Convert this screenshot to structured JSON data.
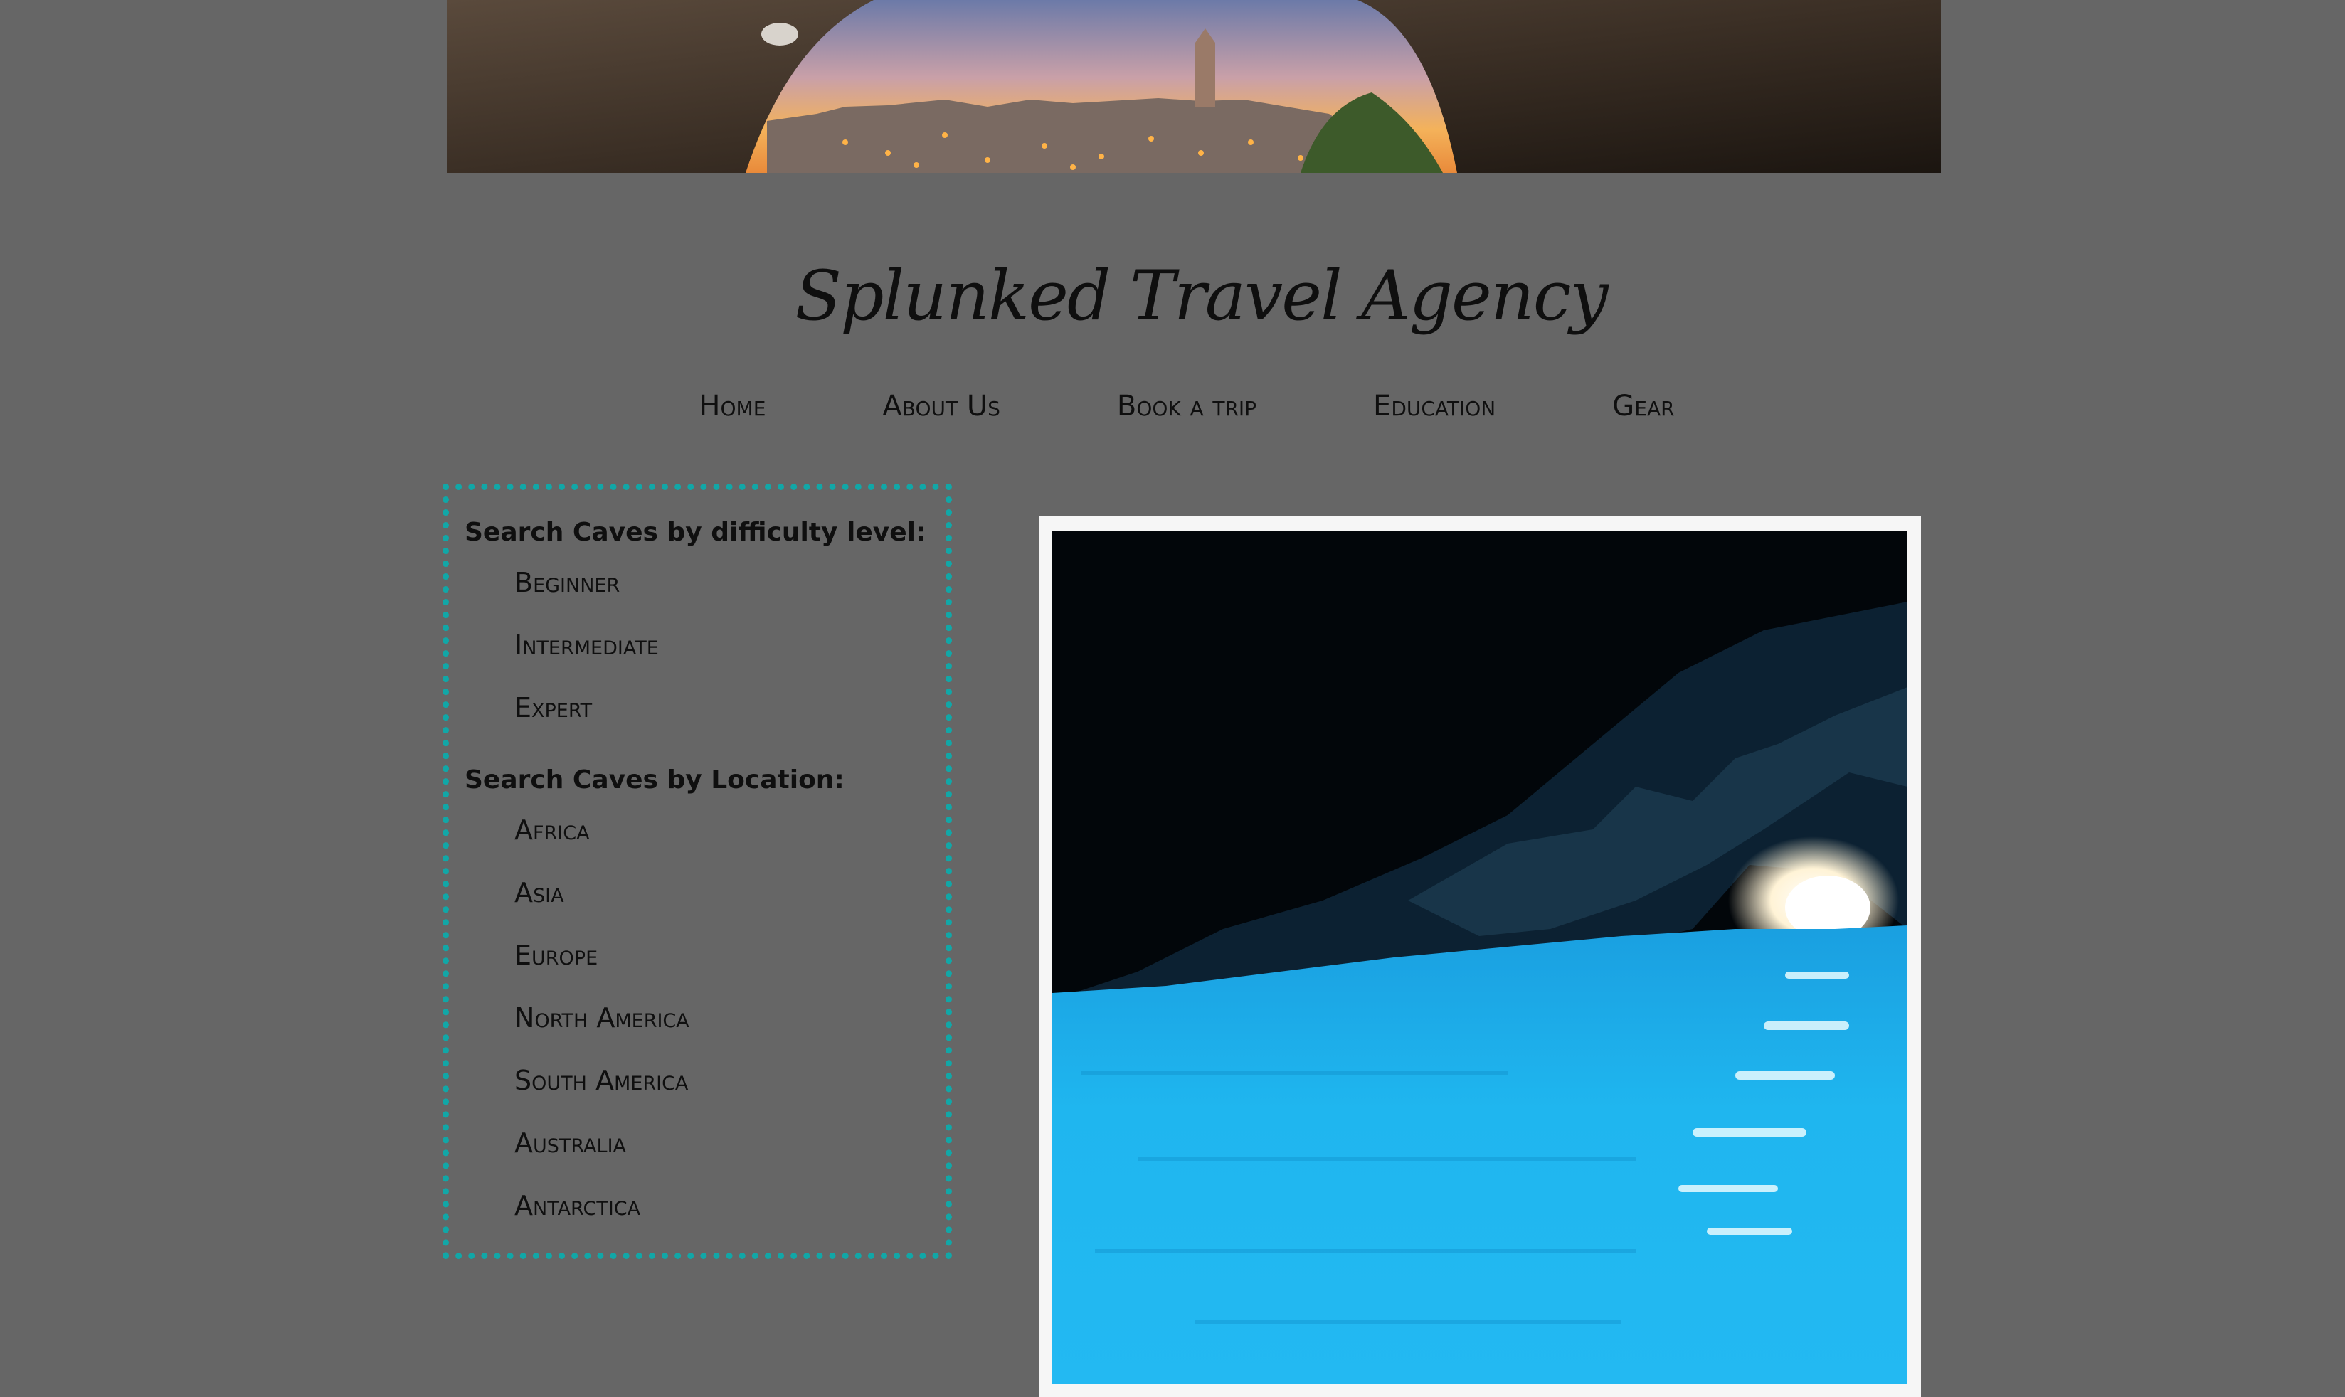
{
  "site": {
    "title": "Splunked Travel Agency"
  },
  "nav": {
    "items": [
      "Home",
      "About Us",
      "Book a trip",
      "Education",
      "Gear"
    ]
  },
  "sidebar": {
    "difficulty": {
      "heading": "Search Caves by difficulty level:",
      "items": [
        "Beginner",
        "Intermediate",
        "Expert"
      ]
    },
    "location": {
      "heading": "Search Caves by Location:",
      "items": [
        "Africa",
        "Asia",
        "Europe",
        "North America",
        "South America",
        "Australia",
        "Antarctica"
      ]
    }
  },
  "colors": {
    "page_background": "#666666",
    "sidebar_border": "#11a7a7",
    "text": "#0f0f0f",
    "water": "#1fb6ef"
  },
  "images": {
    "banner": "cave-arch-overlooking-town-at-sunset",
    "feature": "blue-grotto-sea-cave"
  }
}
